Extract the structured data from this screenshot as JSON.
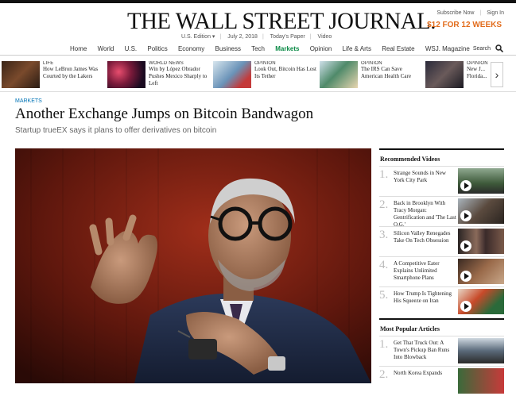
{
  "masthead": {
    "logo": "THE WALL STREET JOURNAL.",
    "edition": "U.S. Edition ▾",
    "date": "July 2, 2018",
    "todays_paper": "Today's Paper",
    "video": "Video",
    "subscribe": "Subscribe Now",
    "signin": "Sign In",
    "promo": "$12 FOR 12 WEEKS"
  },
  "nav": {
    "items": [
      "Home",
      "World",
      "U.S.",
      "Politics",
      "Economy",
      "Business",
      "Tech",
      "Markets",
      "Opinion",
      "Life & Arts",
      "Real Estate",
      "WSJ. Magazine"
    ],
    "active": "Markets",
    "search": "Search"
  },
  "strip": [
    {
      "tag": "LIFE",
      "title": "How LeBron James Was Courted by the Lakers"
    },
    {
      "tag": "WORLD NEWS",
      "title": "Win by López Obrador Pushes Mexico Sharply to Left"
    },
    {
      "tag": "OPINION",
      "title": "Look Out, Bitcoin Has Lost Its Tether"
    },
    {
      "tag": "OPINION",
      "title": "The IRS Can Save American Health Care"
    },
    {
      "tag": "OPINION",
      "title": "New J... Florida..."
    }
  ],
  "article": {
    "section": "MARKETS",
    "headline": "Another Exchange Jumps on Bitcoin Bandwagon",
    "dek": "Startup trueEX says it plans to offer derivatives on bitcoin"
  },
  "rail": {
    "videos_title": "Recommended Videos",
    "videos": [
      {
        "num": "1.",
        "title": "Strange Sounds in New York City Park"
      },
      {
        "num": "2.",
        "title": "Back in Brooklyn With Tracy Morgan: Gentrification and 'The Last O.G.'"
      },
      {
        "num": "3.",
        "title": "Silicon Valley Renegades Take On Tech Obsession"
      },
      {
        "num": "4.",
        "title": "A Competitive Eater Explains Unlimited Smartphone Plans"
      },
      {
        "num": "5.",
        "title": "How Trump Is Tightening His Squeeze on Iran"
      }
    ],
    "popular_title": "Most Popular Articles",
    "popular": [
      {
        "num": "1.",
        "title": "Get That Truck Out: A Town's Pickup Ban Runs Into Blowback"
      },
      {
        "num": "2.",
        "title": "North Korea Expands"
      }
    ]
  },
  "colors": {
    "accent": "#0a8a45",
    "promo": "#e26c1c",
    "section": "#0274b6"
  }
}
